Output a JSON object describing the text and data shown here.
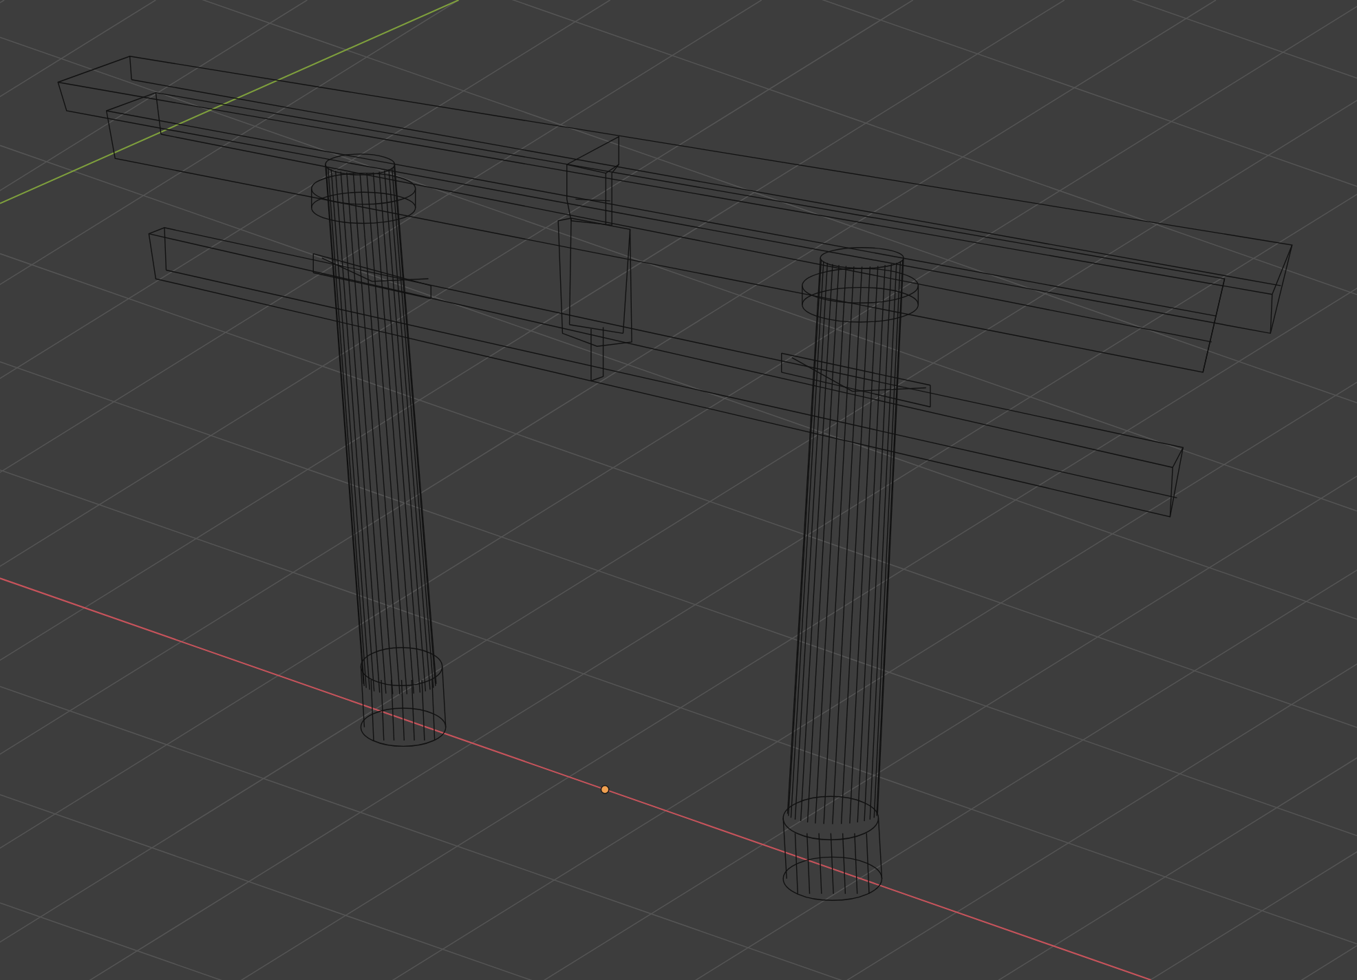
{
  "viewport": {
    "wireframe": true
  }
}
